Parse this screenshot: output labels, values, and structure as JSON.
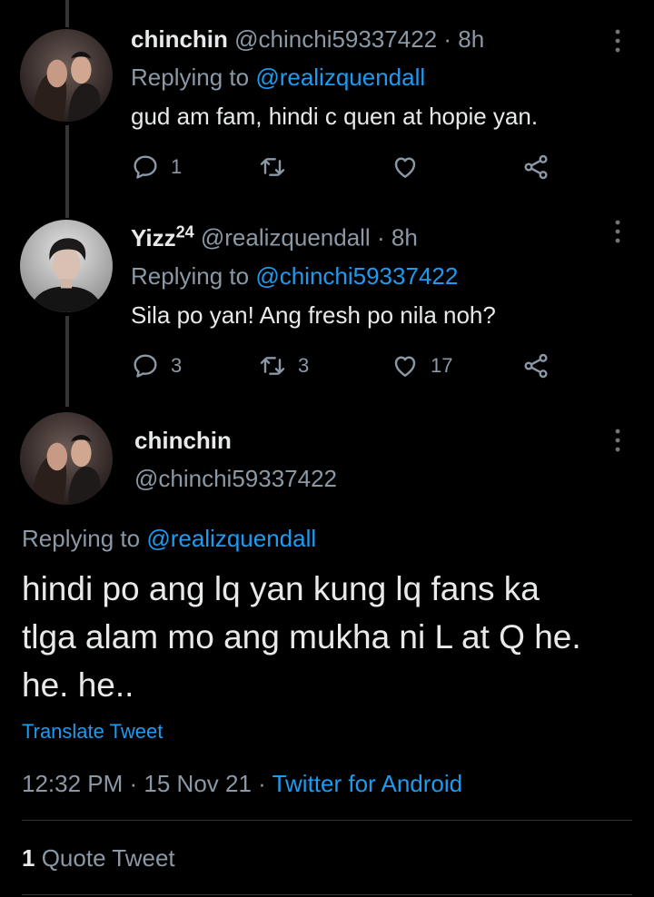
{
  "tweets": [
    {
      "name": "chinchin",
      "handle": "@chinchi59337422",
      "time": "8h",
      "replying_prefix": "Replying to",
      "replying_to": "@realizquendall",
      "text": "gud am fam, hindi c quen at hopie yan.",
      "replies": "1",
      "retweets": "",
      "likes": ""
    },
    {
      "name": "Yizz",
      "name_sup": "24",
      "handle": "@realizquendall",
      "time": "8h",
      "replying_prefix": "Replying to",
      "replying_to": "@chinchi59337422",
      "text": "Sila po yan! Ang fresh po nila noh?",
      "replies": "3",
      "retweets": "3",
      "likes": "17"
    }
  ],
  "main": {
    "name": "chinchin",
    "handle": "@chinchi59337422",
    "replying_prefix": "Replying to",
    "replying_to": "@realizquendall",
    "text_line1": "hindi po ang lq yan kung lq fans ka",
    "text_line2": "tlga alam mo ang mukha ni L at Q he.",
    "text_line3": "he. he..",
    "translate": "Translate Tweet",
    "timestamp": "12:32 PM · 15 Nov 21 ·",
    "source": "Twitter for Android",
    "quote_count": "1",
    "quote_label": "Quote Tweet"
  },
  "icons": [
    "reply-icon",
    "retweet-icon",
    "like-icon",
    "share-icon",
    "more-icon"
  ],
  "colors": {
    "background": "#000000",
    "link": "#1d9bf0",
    "muted": "#8b98a5",
    "text": "#e7e9ea"
  }
}
